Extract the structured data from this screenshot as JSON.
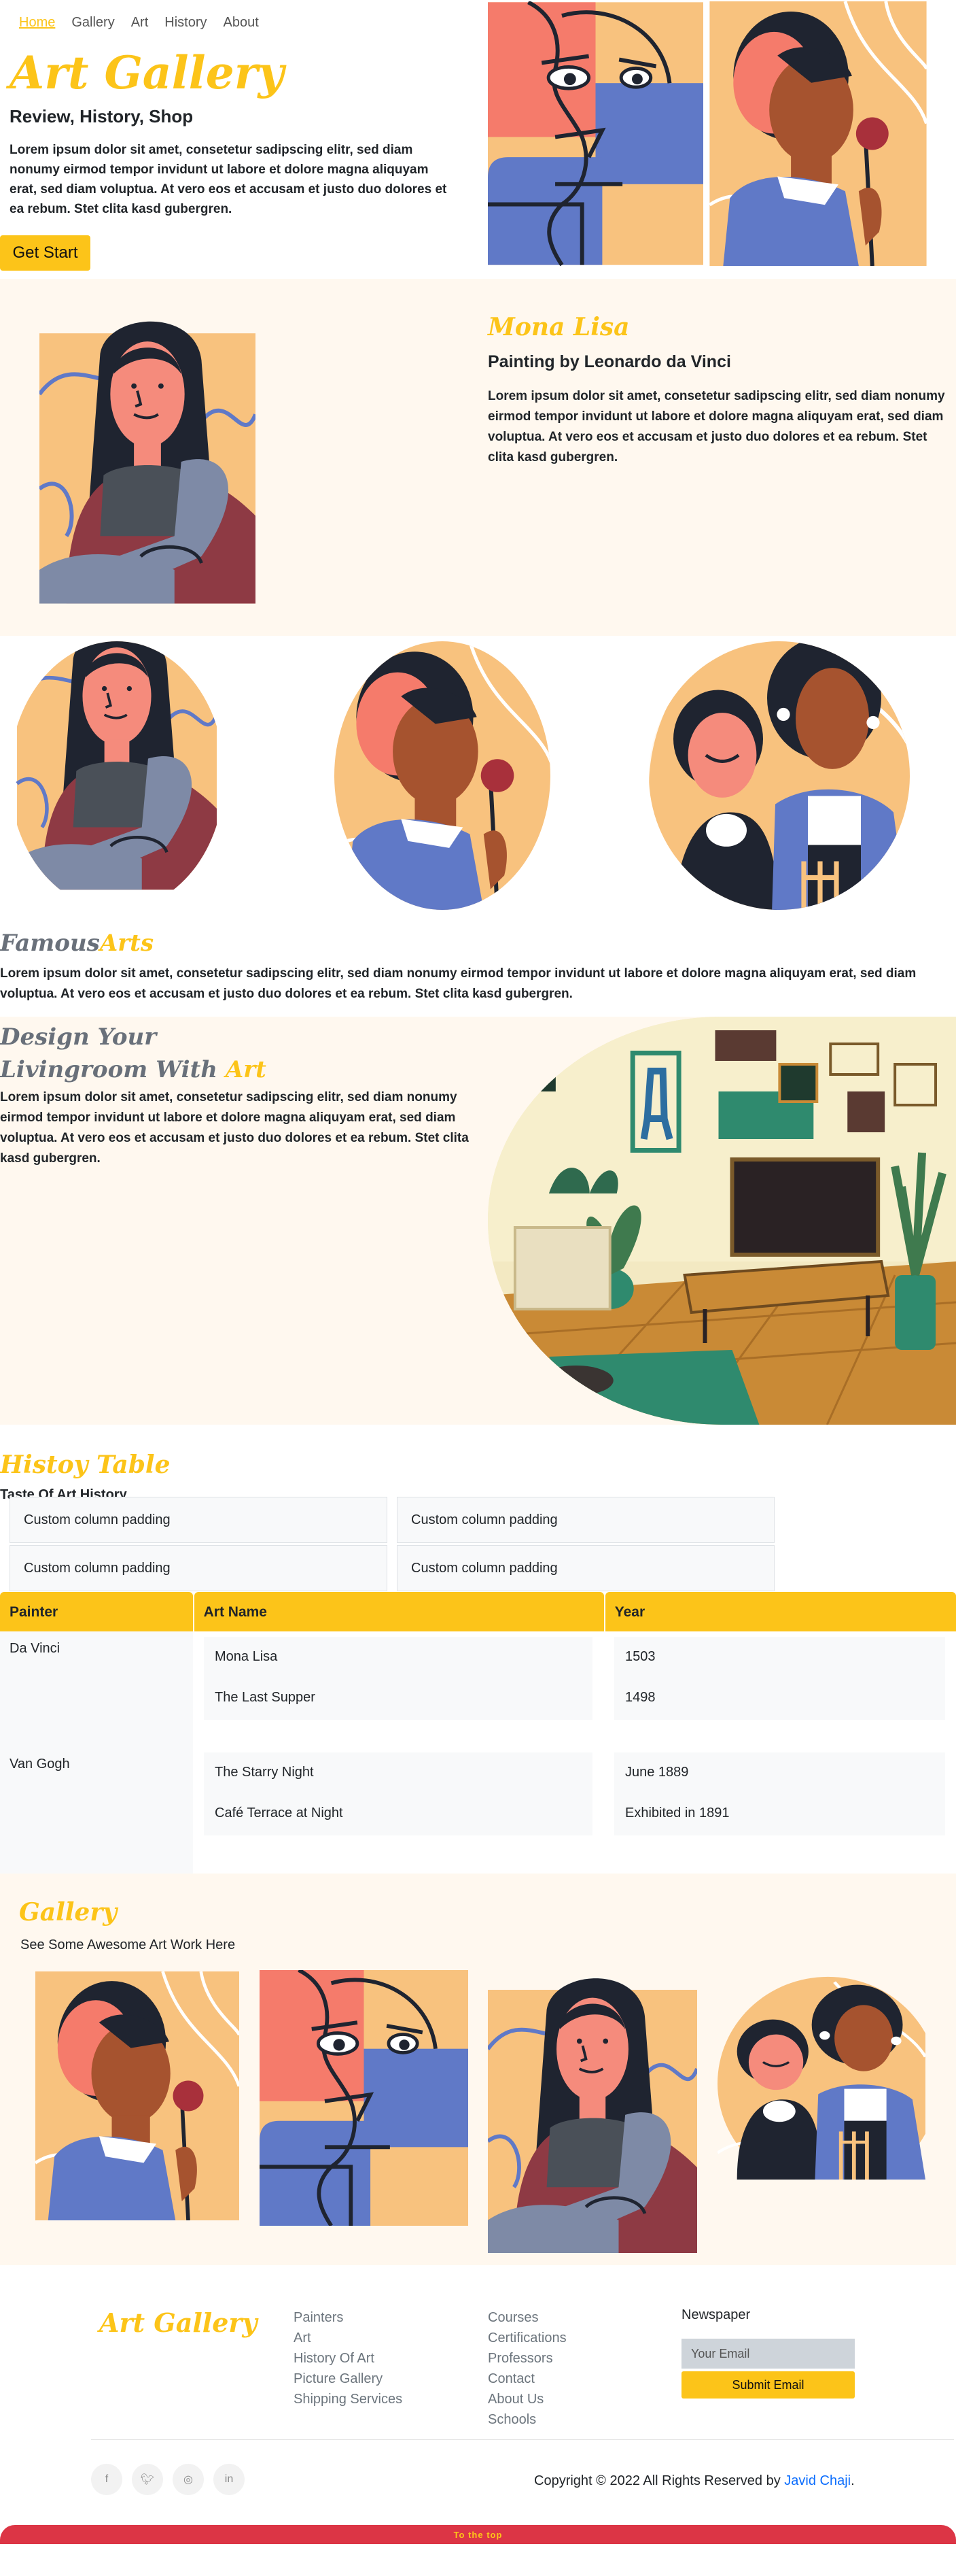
{
  "nav": {
    "items": [
      "Home",
      "Gallery",
      "Art",
      "History",
      "About"
    ]
  },
  "hero": {
    "title": "Art Gallery",
    "subtitle": "Review, History, Shop",
    "text": "Lorem ipsum dolor sit amet, consetetur sadipscing elitr, sed diam nonumy eirmod tempor invidunt ut labore et dolore magna aliquyam erat, sed diam voluptua. At vero eos et accusam et justo duo dolores et ea rebum. Stet clita kasd gubergren.",
    "button": "Get Start"
  },
  "feature": {
    "title": "Mona Lisa",
    "subtitle": "Painting by Leonardo da Vinci",
    "text": "Lorem ipsum dolor sit amet, consetetur sadipscing elitr, sed diam nonumy eirmod tempor invidunt ut labore et dolore magna aliquyam erat, sed diam voluptua. At vero eos et accusam et justo duo dolores et ea rebum. Stet clita kasd gubergren."
  },
  "famous": {
    "title_a": "Famous",
    "title_b": "Arts",
    "text": "Lorem ipsum dolor sit amet, consetetur sadipscing elitr, sed diam nonumy eirmod tempor invidunt ut labore et dolore magna aliquyam erat, sed diam voluptua. At vero eos et accusam et justo duo dolores et ea rebum. Stet clita kasd gubergren."
  },
  "living": {
    "line1": "Design Your",
    "line2_a": "Livingroom With",
    "line2_b": "Art",
    "text": "Lorem ipsum dolor sit amet, consetetur sadipscing elitr, sed diam nonumy eirmod tempor invidunt ut labore et dolore magna aliquyam erat, sed diam voluptua. At vero eos et accusam et justo duo dolores et ea rebum. Stet clita kasd gubergren."
  },
  "history": {
    "title": "Histoy Table",
    "subtitle": "Taste Of Art History",
    "padding_cells": [
      "Custom column padding",
      "Custom column padding",
      "Custom column padding",
      "Custom column padding"
    ],
    "headers": [
      "Painter",
      "Art Name",
      "Year"
    ],
    "rows": [
      {
        "painter": "Da Vinci",
        "arts": [
          "Mona Lisa",
          "The Last Supper"
        ],
        "years": [
          "1503",
          "1498"
        ]
      },
      {
        "painter": "Van Gogh",
        "arts": [
          "The Starry Night",
          "Café Terrace at Night"
        ],
        "years": [
          "June 1889",
          "Exhibited in 1891"
        ]
      }
    ]
  },
  "gallery": {
    "title": "Gallery",
    "subtitle": "See Some Awesome Art Work Here"
  },
  "footer": {
    "logo": "Art Gallery",
    "col1": [
      "Painters",
      "Art",
      "History Of Art",
      "Picture Gallery",
      "Shipping Services"
    ],
    "col2": [
      "Courses",
      "Certifications",
      "Professors",
      "Contact",
      "About Us",
      "Schools"
    ],
    "newsletter": "Newspaper",
    "email_placeholder": "Your Email",
    "submit": "Submit Email",
    "copyright": "Copyright © 2022 All Rights Reserved by",
    "author": "Javid Chaji",
    "to_top": "To the top"
  },
  "icons": [
    "facebook-icon",
    "twitter-icon",
    "instagram-icon",
    "linkedin-icon"
  ],
  "colors": {
    "accent": "#fcc419",
    "cream": "#fff8ef",
    "red": "#dc3545",
    "link": "#0d6efd"
  }
}
